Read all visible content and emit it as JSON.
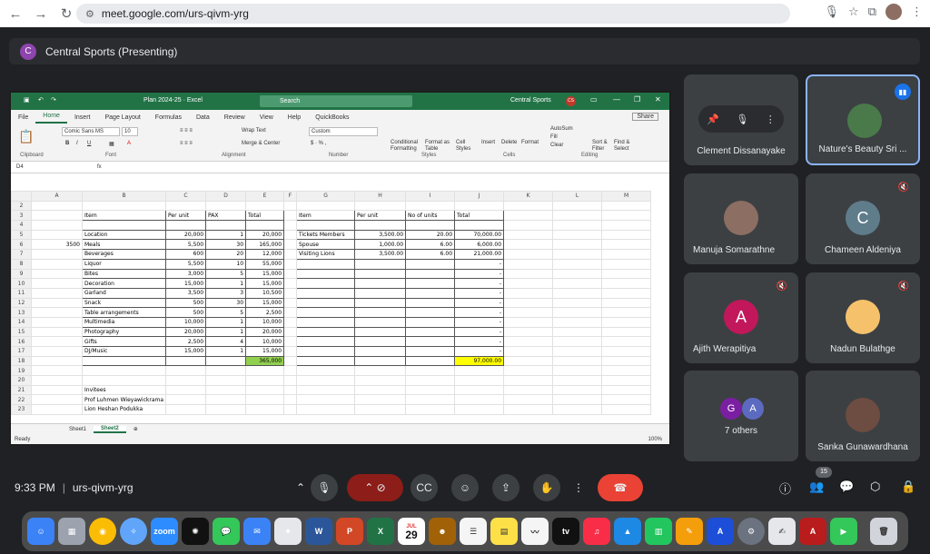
{
  "browser": {
    "url": "meet.google.com/urs-qivm-yrg"
  },
  "presenting": {
    "avatar_letter": "C",
    "title": "Central Sports (Presenting)"
  },
  "excel": {
    "filename": "Plan 2024-25  ·  Excel",
    "search_placeholder": "Search",
    "user_name": "Central Sports",
    "user_initials": "CS",
    "menu_tabs": [
      "File",
      "Home",
      "Insert",
      "Page Layout",
      "Formulas",
      "Data",
      "Review",
      "View",
      "Help",
      "QuickBooks"
    ],
    "share_label": "Share",
    "ribbon": {
      "font_name": "Comic Sans MS",
      "font_size": "10",
      "wrap_text": "Wrap Text",
      "merge_center": "Merge & Center",
      "number_format": "Custom",
      "conditional_formatting": "Conditional Formatting",
      "format_as_table": "Format as Table",
      "cell_styles": "Cell Styles",
      "insert": "Insert",
      "delete": "Delete",
      "format": "Format",
      "autosum": "AutoSum",
      "fill": "Fill",
      "clear": "Clear",
      "sort_filter": "Sort & Filter",
      "find_select": "Find & Select",
      "groups": [
        "Clipboard",
        "Font",
        "Alignment",
        "Number",
        "Styles",
        "Cells",
        "Editing"
      ]
    },
    "name_box": "D4",
    "fx": "fx",
    "columns": [
      "A",
      "B",
      "C",
      "D",
      "E",
      "F",
      "G",
      "H",
      "I",
      "J",
      "K",
      "L",
      "M"
    ],
    "rows": [
      {
        "n": "2",
        "c": [
          "",
          "",
          "",
          "",
          "",
          "",
          "",
          "",
          "",
          "",
          "",
          "",
          ""
        ]
      },
      {
        "n": "3",
        "c": [
          "",
          "Item",
          "Per unit",
          "PAX",
          "Total",
          "",
          "Item",
          "Per unit",
          "No of units",
          "Total",
          "",
          "",
          ""
        ]
      },
      {
        "n": "4",
        "c": [
          "",
          "",
          "",
          "",
          "",
          "",
          "",
          "",
          "",
          "",
          "",
          "",
          ""
        ]
      },
      {
        "n": "5",
        "c": [
          "",
          "Location",
          "20,000",
          "1",
          "20,000",
          "",
          "Tickets Members",
          "3,500.00",
          "20.00",
          "70,000.00",
          "",
          "",
          ""
        ]
      },
      {
        "n": "6",
        "c": [
          "3500",
          "Meals",
          "5,500",
          "30",
          "165,000",
          "",
          "Spouse",
          "1,000.00",
          "6.00",
          "6,000.00",
          "",
          "",
          ""
        ]
      },
      {
        "n": "7",
        "c": [
          "",
          "Beverages",
          "600",
          "20",
          "12,000",
          "",
          "Visiting Lions",
          "3,500.00",
          "6.00",
          "21,000.00",
          "",
          "",
          ""
        ]
      },
      {
        "n": "8",
        "c": [
          "",
          "Liquor",
          "5,500",
          "10",
          "55,000",
          "",
          "",
          "",
          "",
          "-",
          "",
          "",
          ""
        ]
      },
      {
        "n": "9",
        "c": [
          "",
          "Bites",
          "3,000",
          "5",
          "15,000",
          "",
          "",
          "",
          "",
          "-",
          "",
          "",
          ""
        ]
      },
      {
        "n": "10",
        "c": [
          "",
          "Decoration",
          "15,000",
          "1",
          "15,000",
          "",
          "",
          "",
          "",
          "-",
          "",
          "",
          ""
        ]
      },
      {
        "n": "11",
        "c": [
          "",
          "Garland",
          "3,500",
          "3",
          "10,500",
          "",
          "",
          "",
          "",
          "-",
          "",
          "",
          ""
        ]
      },
      {
        "n": "12",
        "c": [
          "",
          "Snack",
          "500",
          "30",
          "15,000",
          "",
          "",
          "",
          "",
          "-",
          "",
          "",
          ""
        ]
      },
      {
        "n": "13",
        "c": [
          "",
          "Table arrangements",
          "500",
          "5",
          "2,500",
          "",
          "",
          "",
          "",
          "-",
          "",
          "",
          ""
        ]
      },
      {
        "n": "14",
        "c": [
          "",
          "Multimedia",
          "10,000",
          "1",
          "10,000",
          "",
          "",
          "",
          "",
          "-",
          "",
          "",
          ""
        ]
      },
      {
        "n": "15",
        "c": [
          "",
          "Photography",
          "20,000",
          "1",
          "20,000",
          "",
          "",
          "",
          "",
          "-",
          "",
          "",
          ""
        ]
      },
      {
        "n": "16",
        "c": [
          "",
          "Gifts",
          "2,500",
          "4",
          "10,000",
          "",
          "",
          "",
          "",
          "-",
          "",
          "",
          ""
        ]
      },
      {
        "n": "17",
        "c": [
          "",
          "DJ/Music",
          "15,000",
          "1",
          "15,000",
          "",
          "",
          "",
          "",
          "-",
          "",
          "",
          ""
        ]
      },
      {
        "n": "18",
        "c": [
          "",
          "",
          "",
          "",
          "365,000",
          "",
          "",
          "",
          "",
          "97,000.00",
          "",
          "",
          ""
        ]
      },
      {
        "n": "19",
        "c": [
          "",
          "",
          "",
          "",
          "",
          "",
          "",
          "",
          "",
          "",
          "",
          "",
          ""
        ]
      },
      {
        "n": "20",
        "c": [
          "",
          "",
          "",
          "",
          "",
          "",
          "",
          "",
          "",
          "",
          "",
          "",
          ""
        ]
      },
      {
        "n": "21",
        "c": [
          "",
          "Invitees",
          "",
          "",
          "",
          "",
          "",
          "",
          "",
          "",
          "",
          "",
          ""
        ]
      },
      {
        "n": "22",
        "c": [
          "",
          "Prof Luhmen Wieyawickrama",
          "",
          "",
          "",
          "",
          "",
          "",
          "",
          "",
          "",
          "",
          ""
        ]
      },
      {
        "n": "23",
        "c": [
          "",
          "Lion Heshan Podukka",
          "",
          "",
          "",
          "",
          "",
          "",
          "",
          "",
          "",
          "",
          ""
        ]
      }
    ],
    "sheet_tabs": [
      "Sheet1",
      "Sheet2"
    ],
    "status": "Ready",
    "zoom": "100%"
  },
  "participants": [
    {
      "name": "Clement Dissanayake",
      "muted": false
    },
    {
      "name": "Nature's Beauty Sri ...",
      "speaking": true
    },
    {
      "name": "Manuja Somarathne"
    },
    {
      "name": "Chameen Aldeniya",
      "letter": "C",
      "color": "#5f7c8a",
      "muted": true
    },
    {
      "name": "Ajith Werapitiya",
      "letter": "A",
      "color": "#c2185b",
      "muted": true
    },
    {
      "name": "Nadun Bulathge",
      "muted": true
    },
    {
      "name": "7 others",
      "letters": [
        "G",
        "A"
      ],
      "colors": [
        "#7b1fa2",
        "#5c6bc0"
      ]
    },
    {
      "name": "Sanka Gunawardhana"
    }
  ],
  "bottom": {
    "time": "9:33 PM",
    "meeting_code": "urs-qivm-yrg",
    "people_count": "15"
  },
  "dock": {
    "calendar_month": "JUL",
    "calendar_day": "29",
    "zoom_label": "zoom",
    "tv_label": "tv"
  }
}
